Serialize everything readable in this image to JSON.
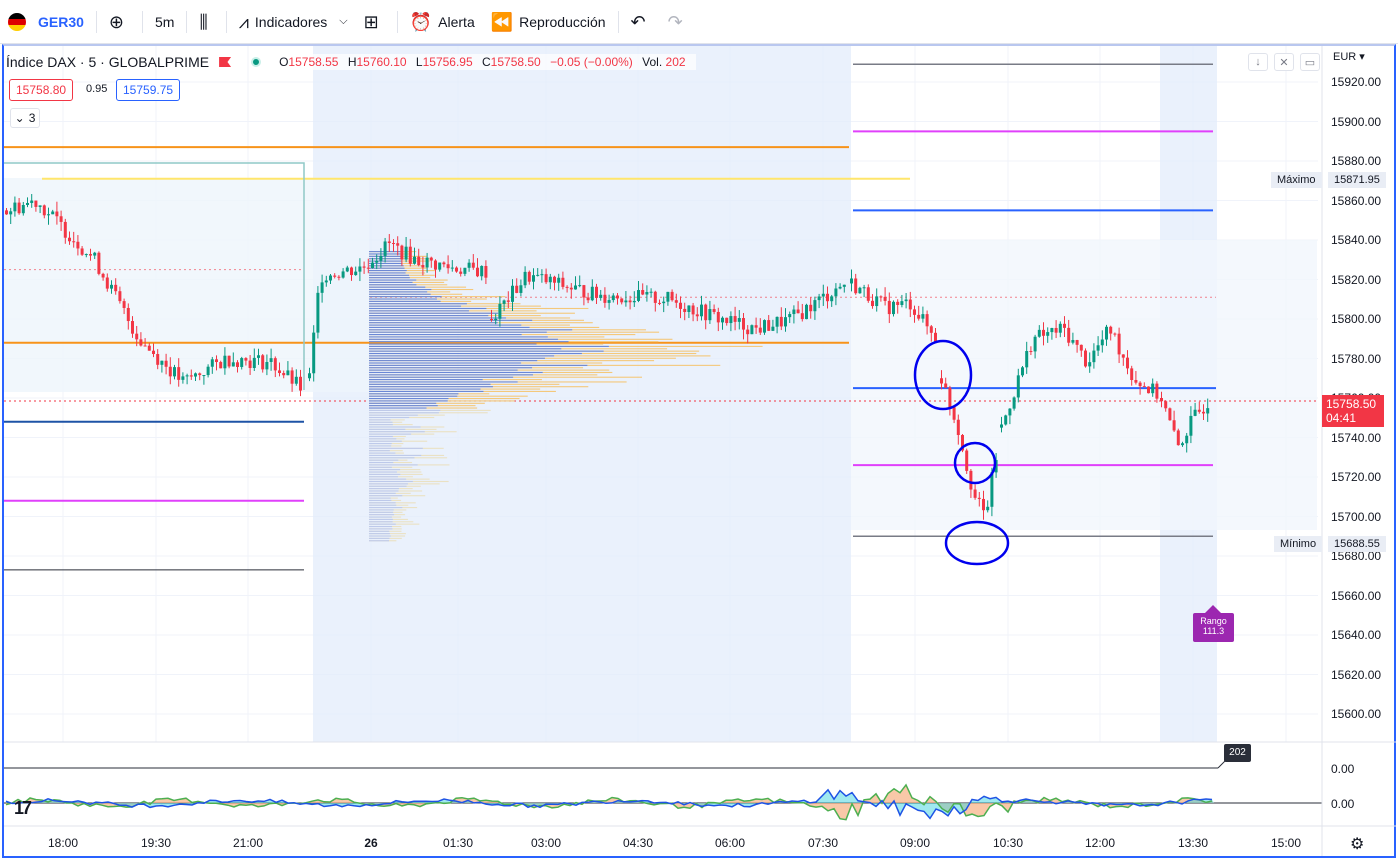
{
  "toolbar": {
    "symbol": "GER30",
    "interval": "5m",
    "indicators": "Indicadores",
    "alert": "Alerta",
    "replay": "Reproducción"
  },
  "legend": {
    "title": "Índice DAX · 5 · GLOBALPRIME",
    "o_label": "O",
    "o": "15758.55",
    "h_label": "H",
    "h": "15760.10",
    "l_label": "L",
    "l": "15756.95",
    "c_label": "C",
    "c": "15758.50",
    "change": "−0.05 (−0.00%)",
    "vol_label": "Vol.",
    "vol": "202"
  },
  "quotes": {
    "sell": "15758.80",
    "spread": "0.95",
    "buy": "15759.75",
    "collapsed_count": "3"
  },
  "price_scale": {
    "currency": "EUR",
    "ticks": [
      "15920.00",
      "15900.00",
      "15880.00",
      "15860.00",
      "15840.00",
      "15820.00",
      "15800.00",
      "15780.00",
      "15760.00",
      "15740.00",
      "15720.00",
      "15700.00",
      "15680.00",
      "15660.00",
      "15640.00",
      "15620.00",
      "15600.00"
    ],
    "max_label": "Máximo",
    "max_value": "15871.95",
    "min_label": "Mínimo",
    "min_value": "15688.55",
    "current_price": "15758.50",
    "countdown": "04:41"
  },
  "time_axis": [
    "18:00",
    "19:30",
    "21:00",
    "26",
    "01:30",
    "03:00",
    "04:30",
    "06:00",
    "07:30",
    "09:00",
    "10:30",
    "12:00",
    "13:30",
    "15:00"
  ],
  "range_badge": {
    "label": "Rango",
    "value": "111.3"
  },
  "volume_badge": "202",
  "indicator_scale": [
    "0.00",
    "0.00"
  ],
  "colors": {
    "up": "#089981",
    "down": "#f23645",
    "accent": "#2962ff",
    "profile_blue": "#5b7fe0",
    "profile_orange": "#f5c36b"
  },
  "chart_data": {
    "type": "candlestick",
    "symbol": "GER30",
    "ylim": [
      15590,
      15930
    ],
    "current": 15758.5,
    "session_high": 15871.95,
    "session_low": 15688.55,
    "range": 111.3
  }
}
